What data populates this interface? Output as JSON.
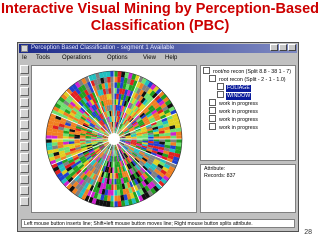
{
  "slide": {
    "title_line1": "Interactive Visual Mining by Perception-Based",
    "title_line2": "Classification (PBC)",
    "page_number": "28"
  },
  "window": {
    "title": "Perception Based Classification - segment 1 Available",
    "menu": [
      "Ie",
      "Tools",
      "Operations",
      "Options",
      "View",
      "Help"
    ]
  },
  "tree": {
    "nodes": [
      {
        "label": "root/no recon (Split 8.8 - 38 1 - 7)",
        "color": "#ffffff",
        "selected": false
      },
      {
        "label": "root recon (Split - 2 - 1 - 1.0)",
        "color": "#ffffff",
        "selected": false
      },
      {
        "label": "FOLIAGE",
        "color": "#ffffff",
        "selected": true
      },
      {
        "label": "WINDOW",
        "color": "#ffffff",
        "selected": true
      },
      {
        "label": "work in progress",
        "color": "#ffffff",
        "selected": false
      },
      {
        "label": "work in progress",
        "color": "#ffffff",
        "selected": false
      },
      {
        "label": "work in progress",
        "color": "#ffffff",
        "selected": false
      },
      {
        "label": "work in progress",
        "color": "#ffffff",
        "selected": false
      }
    ]
  },
  "info": {
    "line1": "Attribute:",
    "line2": "Records: 837"
  },
  "status": "Left mouse button inserts line; Shift+left mouse button moves line; Right mouse button splits attribute.",
  "colors": {
    "title": "#cc0000",
    "window_bg": "#c0c0c0",
    "titlebar": "#1c2a8a",
    "selection": "#0a1c9c"
  }
}
